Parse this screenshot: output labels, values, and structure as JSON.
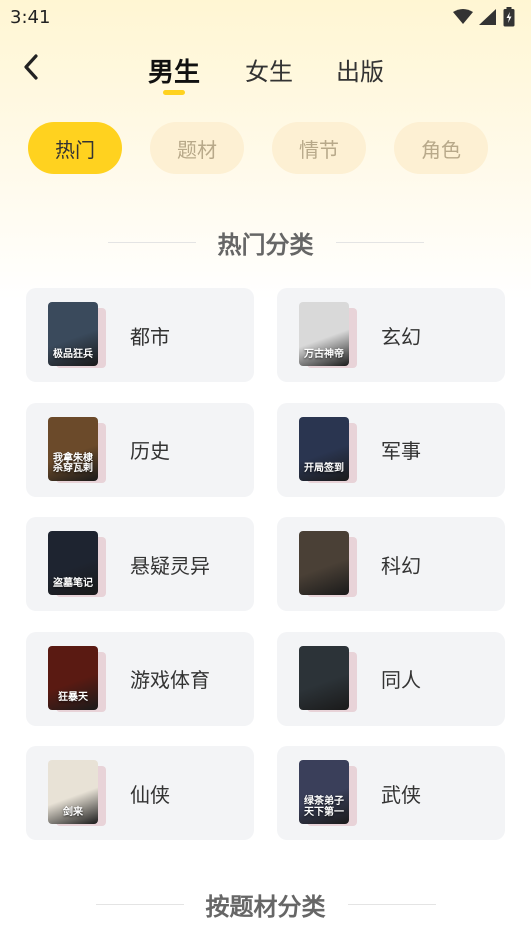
{
  "status_bar": {
    "time": "3:41"
  },
  "header": {
    "back_icon": "chevron-left-icon",
    "tabs": [
      {
        "label": "男生",
        "active": true
      },
      {
        "label": "女生",
        "active": false
      },
      {
        "label": "出版",
        "active": false
      }
    ]
  },
  "filters": [
    {
      "label": "热门",
      "active": true
    },
    {
      "label": "题材",
      "active": false
    },
    {
      "label": "情节",
      "active": false
    },
    {
      "label": "角色",
      "active": false
    }
  ],
  "sections": {
    "hot": "热门分类",
    "by_theme": "按题材分类"
  },
  "categories": [
    {
      "label": "都市",
      "cover_text": "极品狂兵",
      "cover_color": "#3a4a5c"
    },
    {
      "label": "玄幻",
      "cover_text": "万古神帝",
      "cover_color": "#d9d9d9"
    },
    {
      "label": "历史",
      "cover_text": "我拿朱棣杀穿瓦剌",
      "cover_color": "#6b4a2a"
    },
    {
      "label": "军事",
      "cover_text": "开局签到",
      "cover_color": "#2a3550"
    },
    {
      "label": "悬疑灵异",
      "cover_text": "盗墓笔记",
      "cover_color": "#1e2430"
    },
    {
      "label": "科幻",
      "cover_text": "",
      "cover_color": "#4a4036"
    },
    {
      "label": "游戏体育",
      "cover_text": "狂暴天",
      "cover_color": "#5a1a12"
    },
    {
      "label": "同人",
      "cover_text": "",
      "cover_color": "#2c3338"
    },
    {
      "label": "仙侠",
      "cover_text": "剑来",
      "cover_color": "#e8e2d6"
    },
    {
      "label": "武侠",
      "cover_text": "绿茶弟子天下第一",
      "cover_color": "#3a3f5a"
    }
  ],
  "colors": {
    "accent": "#ffd21f",
    "chip_bg": "#fdf0d3",
    "card_bg": "#f3f4f6"
  }
}
